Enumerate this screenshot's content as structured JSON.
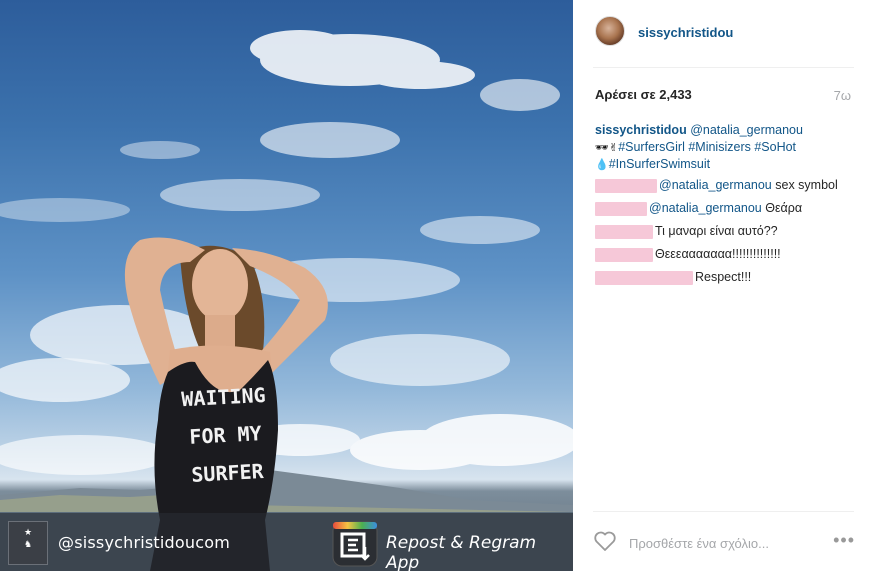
{
  "post": {
    "watermark_handle": "@sissychristidoucom",
    "watermark_app": "Repost & Regram App",
    "swimsuit_text_lines": [
      "WAITING",
      "FOR MY",
      "SURFER"
    ]
  },
  "header": {
    "username": "sissychristidou",
    "avatar_icon": "profile-avatar"
  },
  "stats": {
    "likes": "Αρέσει σε 2,433",
    "age": "7ω"
  },
  "caption": {
    "user": "sissychristidou",
    "mention": "@natalia_germanou",
    "emojis_line2": "🕶✌",
    "tags_line2": "#SurfersGirl #Minisizers #SoHot",
    "emoji_line3": "💧",
    "tag_line3": "#InSurferSwimsuit"
  },
  "comments": [
    {
      "mention": "@natalia_germanou",
      "text": " sex symbol"
    },
    {
      "mention": "@natalia_germanou",
      "text": " Θεάρα"
    },
    {
      "mention": "",
      "text": "Τι μαναρι είναι αυτό??"
    },
    {
      "mention": "",
      "text": "Θεεεααααααα!!!!!!!!!!!!!!"
    },
    {
      "mention": "",
      "text": "Respect!!!"
    }
  ],
  "footer": {
    "comment_placeholder": "Προσθέστε ένα σχόλιο...",
    "more_label": "•••",
    "like_icon": "heart-icon"
  },
  "colors": {
    "link": "#125688",
    "redaction": "#f6c8d8",
    "muted": "#a5a7aa"
  }
}
